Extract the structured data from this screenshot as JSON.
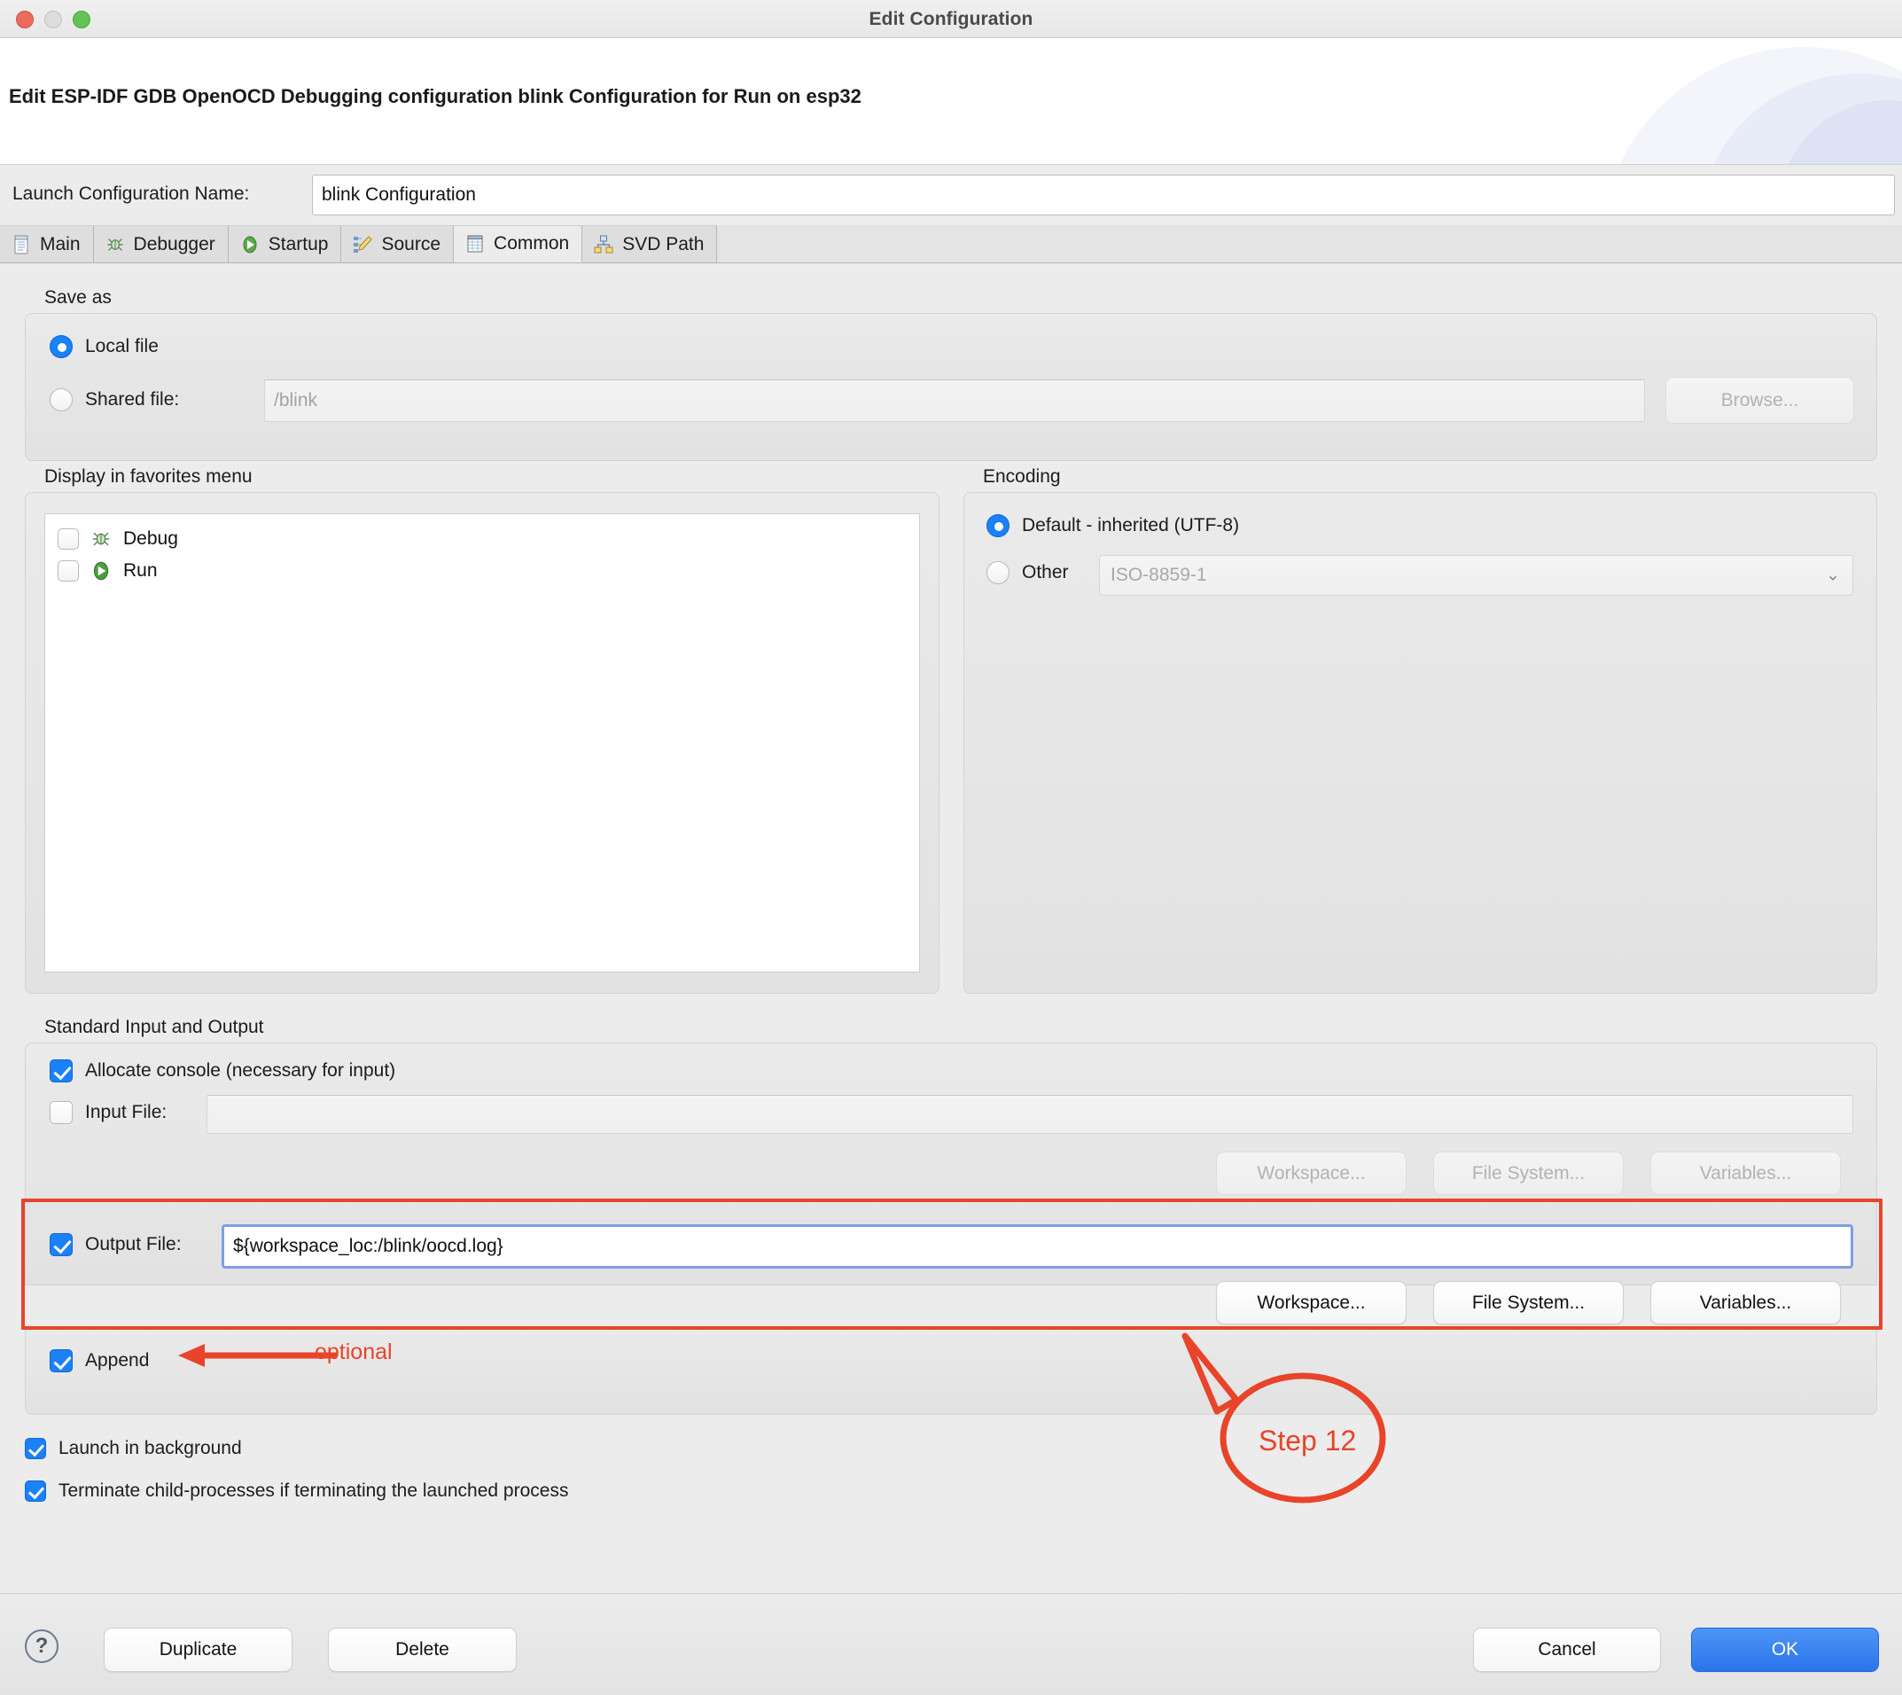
{
  "window": {
    "title": "Edit Configuration",
    "traffic_lights": [
      "close-red",
      "minimize-gray",
      "zoom-green"
    ]
  },
  "header": {
    "title": "Edit ESP-IDF GDB OpenOCD Debugging configuration blink Configuration for Run on esp32"
  },
  "launch_config": {
    "label": "Launch Configuration Name:",
    "value": "blink Configuration"
  },
  "tabs": [
    {
      "label": "Main",
      "icon": "document-icon",
      "active": false
    },
    {
      "label": "Debugger",
      "icon": "bug-icon",
      "active": false
    },
    {
      "label": "Startup",
      "icon": "play-icon",
      "active": false
    },
    {
      "label": "Source",
      "icon": "source-edit-icon",
      "active": false
    },
    {
      "label": "Common",
      "icon": "table-icon",
      "active": true
    },
    {
      "label": "SVD Path",
      "icon": "hierarchy-icon",
      "active": false
    }
  ],
  "save_as": {
    "group_label": "Save as",
    "local_file": {
      "label": "Local file",
      "selected": true
    },
    "shared_file": {
      "label": "Shared file:",
      "selected": false,
      "placeholder": "/blink",
      "value": ""
    },
    "browse_button": {
      "label": "Browse...",
      "disabled": true
    }
  },
  "favorites": {
    "group_label": "Display in favorites menu",
    "items": [
      {
        "label": "Debug",
        "checked": false,
        "icon": "bug-icon"
      },
      {
        "label": "Run",
        "checked": false,
        "icon": "run-icon"
      }
    ]
  },
  "encoding": {
    "group_label": "Encoding",
    "default_option": {
      "label": "Default - inherited (UTF-8)",
      "selected": true
    },
    "other_option": {
      "label": "Other",
      "selected": false
    },
    "other_value": "ISO-8859-1"
  },
  "std_io": {
    "group_label": "Standard Input and Output",
    "allocate_console": {
      "label": "Allocate console (necessary for input)",
      "checked": true
    },
    "input_file": {
      "label": "Input File:",
      "checked": false,
      "value": ""
    },
    "input_buttons": [
      {
        "label": "Workspace...",
        "disabled": true
      },
      {
        "label": "File System...",
        "disabled": true
      },
      {
        "label": "Variables...",
        "disabled": true
      }
    ],
    "output_file": {
      "label": "Output File:",
      "checked": true,
      "value": "${workspace_loc:/blink/oocd.log}"
    },
    "output_buttons": [
      {
        "label": "Workspace...",
        "disabled": false
      },
      {
        "label": "File System...",
        "disabled": false
      },
      {
        "label": "Variables...",
        "disabled": false
      }
    ],
    "append": {
      "label": "Append",
      "checked": true
    }
  },
  "bottom_options": [
    {
      "label": "Launch in background",
      "checked": true
    },
    {
      "label": "Terminate child-processes if terminating the launched process",
      "checked": true
    }
  ],
  "footer": {
    "help_glyph": "?",
    "duplicate": "Duplicate",
    "delete": "Delete",
    "cancel": "Cancel",
    "ok": "OK"
  },
  "annotations": {
    "optional_label": "optional",
    "step_label": "Step 12",
    "highlight_color": "#e8442a"
  }
}
